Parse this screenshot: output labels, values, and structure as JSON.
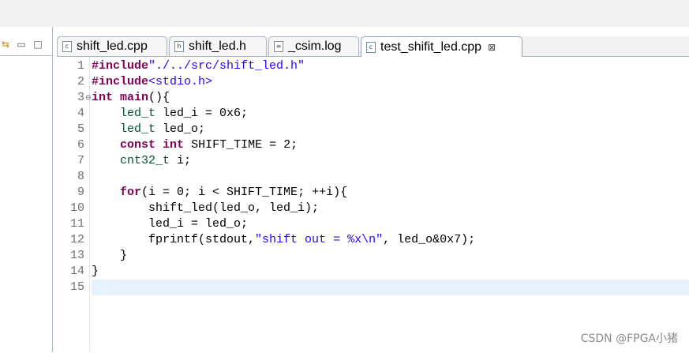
{
  "left_panel": {
    "icons": [
      "sync-icon",
      "minimize-icon",
      "maximize-icon"
    ]
  },
  "tabs": [
    {
      "label": "shift_led.cpp",
      "icon": "c-source-file-icon",
      "active": false
    },
    {
      "label": "shift_led.h",
      "icon": "h-header-file-icon",
      "active": false
    },
    {
      "label": "_csim.log",
      "icon": "log-file-icon",
      "active": false
    },
    {
      "label": "test_shifit_led.cpp",
      "icon": "c-source-file-icon",
      "active": true
    }
  ],
  "close_glyph": "⊠",
  "editor": {
    "line_numbers": [
      "1",
      "2",
      "3",
      "4",
      "5",
      "6",
      "7",
      "8",
      "9",
      "10",
      "11",
      "12",
      "13",
      "14",
      "15"
    ],
    "current_line": 15,
    "code": [
      [
        {
          "t": "#include",
          "c": "kw-pp"
        },
        {
          "t": "\"./../src/shift_led.h\"",
          "c": "str"
        }
      ],
      [
        {
          "t": "#include",
          "c": "kw-pp"
        },
        {
          "t": "<stdio.h>",
          "c": "str"
        }
      ],
      [
        {
          "t": "int",
          "c": "kw"
        },
        {
          "t": " "
        },
        {
          "t": "main",
          "c": "kw"
        },
        {
          "t": "(){"
        }
      ],
      [
        {
          "t": "    "
        },
        {
          "t": "led_t",
          "c": "ty"
        },
        {
          "t": " led_i = 0x6;"
        }
      ],
      [
        {
          "t": "    "
        },
        {
          "t": "led_t",
          "c": "ty"
        },
        {
          "t": " led_o;"
        }
      ],
      [
        {
          "t": "    "
        },
        {
          "t": "const",
          "c": "kw"
        },
        {
          "t": " "
        },
        {
          "t": "int",
          "c": "kw"
        },
        {
          "t": " SHIFT_TIME = 2;"
        }
      ],
      [
        {
          "t": "    "
        },
        {
          "t": "cnt32_t",
          "c": "ty"
        },
        {
          "t": " i;"
        }
      ],
      [
        {
          "t": ""
        }
      ],
      [
        {
          "t": "    "
        },
        {
          "t": "for",
          "c": "kw"
        },
        {
          "t": "(i = 0; i < SHIFT_TIME; ++i){"
        }
      ],
      [
        {
          "t": "        shift_led(led_o, led_i);"
        }
      ],
      [
        {
          "t": "        led_i = led_o;"
        }
      ],
      [
        {
          "t": "        fprintf(stdout,"
        },
        {
          "t": "\"shift out = %x\\n\"",
          "c": "str"
        },
        {
          "t": ", led_o&0x7);"
        }
      ],
      [
        {
          "t": "    }"
        }
      ],
      [
        {
          "t": "}"
        }
      ],
      [
        {
          "t": ""
        }
      ]
    ]
  },
  "watermark": "CSDN @FPGA小猪"
}
